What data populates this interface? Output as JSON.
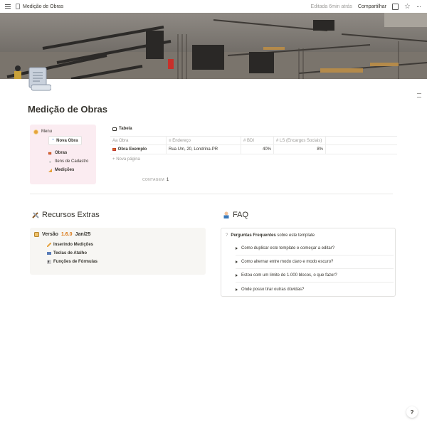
{
  "topbar": {
    "breadcrumb": "Medição de Obras",
    "edited": "Editada 6min atrás",
    "share": "Compartilhar"
  },
  "page": {
    "title": "Medição de Obras"
  },
  "menu": {
    "label": "Menu",
    "new_button": "Nova Obra",
    "items": [
      {
        "label": "Obras",
        "bold": true,
        "icon": "construction-icon"
      },
      {
        "label": "Itens de Cadastro",
        "bold": false,
        "icon": "dot-icon"
      },
      {
        "label": "Medições",
        "bold": true,
        "icon": "ruler-icon"
      }
    ]
  },
  "table": {
    "title": "Tabela",
    "columns": [
      {
        "prefix": "Aa",
        "label": "Obra"
      },
      {
        "prefix": "≡",
        "label": "Endereço"
      },
      {
        "prefix": "#",
        "label": "BDI"
      },
      {
        "prefix": "#",
        "label": "LS (Encargos Sociais)"
      }
    ],
    "rows": [
      {
        "obra": "Obra Exemplo",
        "endereco": "Rua Um, 20, Londrina-PR",
        "bdi": "40%",
        "ls": "8%"
      }
    ],
    "new_row": "Nova página",
    "count_label": "CONTAGEM",
    "count_value": "1"
  },
  "extras": {
    "heading": "Recursos Extras",
    "version_prefix": "Versão",
    "version_number": "1.6.0",
    "version_date": "Jan/25",
    "items": [
      "Inserindo Medições",
      "Teclas de Atalho",
      "Funções de Fórmulas"
    ]
  },
  "faq": {
    "heading": "FAQ",
    "intro_bold": "Perguntas Frequentes",
    "intro_rest": "sobre este template",
    "items": [
      "Como duplicar este template e começar a editar?",
      "Como alternar entre modo claro e modo escuro?",
      "Estou com um limite de 1.000 blocos, o que fazer?",
      "Onde posso tirar outras dúvidas?"
    ]
  },
  "help": {
    "label": "?"
  },
  "colors": {
    "menu_bg": "#fbecf1",
    "extras_bg": "#f7f6f3",
    "version_accent": "#d9730d",
    "text": "#37352f",
    "muted": "#9b9a97"
  }
}
